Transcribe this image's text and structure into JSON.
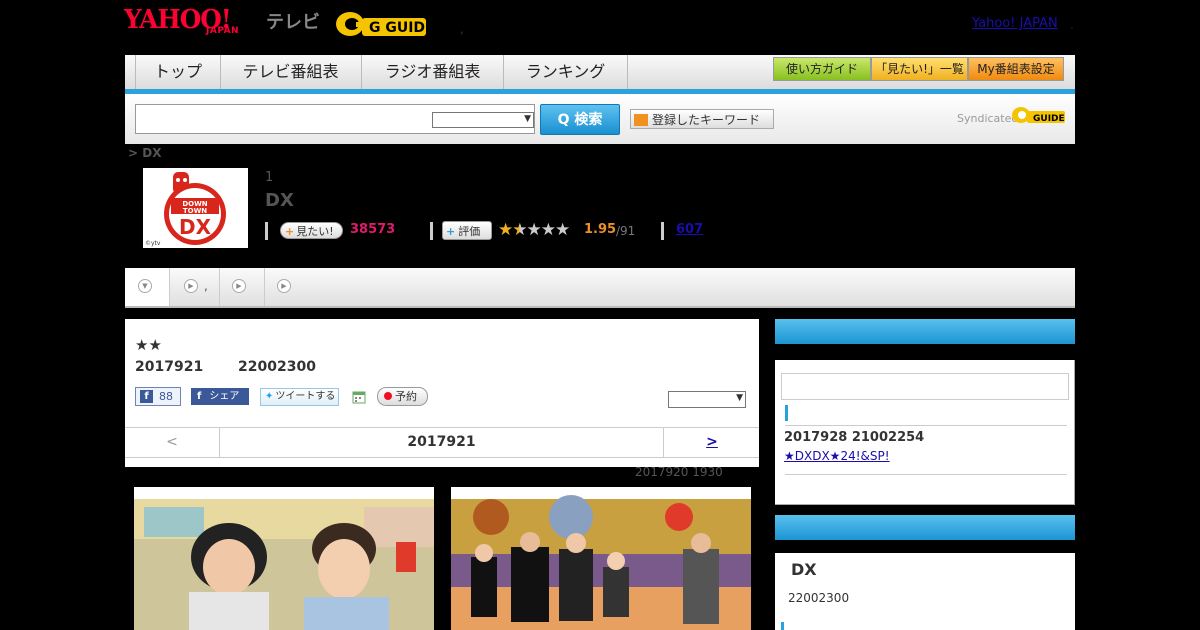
{
  "header": {
    "logo_yahoo": "YAHOO!",
    "logo_japan": "JAPAN",
    "logo_tv": "テレビ",
    "logo_gguide": "G GUIDE",
    "yahoo_japan_link": "Yahoo! JAPAN",
    "dot_right": ".",
    "dot_center": ","
  },
  "nav": {
    "tabs": [
      "トップ",
      "テレビ番組表",
      "ラジオ番組表",
      "ランキング"
    ],
    "buttons": [
      "使い方ガイド",
      "「見たい!」一覧",
      "My番組表設定"
    ]
  },
  "search": {
    "button_label": "Q 検索",
    "keyword_button": "登録したキーワード",
    "syndicated": "Syndicated"
  },
  "breadcrumb": "> DX",
  "program": {
    "logo_text_top": "DOWN TOWN",
    "logo_text_main": "DX",
    "logo_credit": "©ytv",
    "number": "1",
    "title": "DX",
    "mitai_label": "見たい!",
    "mitai_count": "38573",
    "rate_label": "評価",
    "rating_stars": "★★★★★",
    "rating": 1.95,
    "score": "1.95",
    "score_of": "/91",
    "reviews_link": "607"
  },
  "tabs": {
    "item2_label": ","
  },
  "episode": {
    "rating_stars": "★★",
    "date": "2017921",
    "time": "22002300",
    "fb_count": "88",
    "share_label": "シェア",
    "tweet_label": "ツイートする",
    "reserve_label": "予約",
    "nav_prev": "<",
    "nav_date": "2017921",
    "nav_next": ">",
    "updated": "2017920  1930"
  },
  "sidebar": {
    "date": "2017928  21002254",
    "link": "★DXDX★24!&SP!",
    "card2_title": "DX",
    "card2_time": "22002300"
  },
  "colors": {
    "accent_blue": "#2aa3dc",
    "yahoo_red": "#ff0033",
    "mitai_pink": "#e0196c",
    "score_orange": "#e9902a",
    "link_blue": "#1a0dab"
  }
}
